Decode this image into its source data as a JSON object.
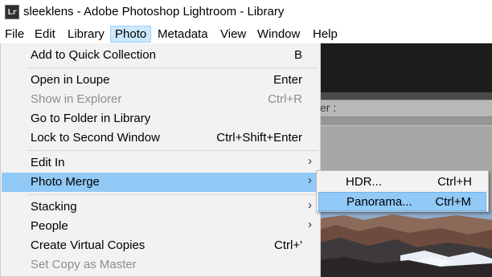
{
  "window": {
    "title": "sleeklens - Adobe Photoshop Lightroom - Library",
    "app_icon_text": "Lr"
  },
  "menubar": {
    "items": [
      "File",
      "Edit",
      "Library",
      "Photo",
      "Metadata",
      "View",
      "Window",
      "Help"
    ],
    "active": "Photo"
  },
  "background_app": {
    "filter_label": "er :"
  },
  "photo_menu": {
    "items": [
      {
        "label": "Add to Quick Collection",
        "shortcut": "B",
        "enabled": true
      },
      {
        "label": "Open in Loupe",
        "shortcut": "Enter",
        "enabled": true
      },
      {
        "label": "Show in Explorer",
        "shortcut": "Ctrl+R",
        "enabled": false
      },
      {
        "label": "Go to Folder in Library",
        "shortcut": "",
        "enabled": true
      },
      {
        "label": "Lock to Second Window",
        "shortcut": "Ctrl+Shift+Enter",
        "enabled": true
      },
      {
        "label": "Edit In",
        "submenu": true,
        "enabled": true
      },
      {
        "label": "Photo Merge",
        "submenu": true,
        "enabled": true,
        "highlighted": true
      },
      {
        "label": "Stacking",
        "submenu": true,
        "enabled": true
      },
      {
        "label": "People",
        "submenu": true,
        "enabled": true
      },
      {
        "label": "Create Virtual Copies",
        "shortcut": "Ctrl+'",
        "enabled": true
      },
      {
        "label": "Set Copy as Master",
        "shortcut": "",
        "enabled": false
      }
    ],
    "submenu_arrow": "›"
  },
  "photo_merge_submenu": {
    "items": [
      {
        "label": "HDR...",
        "shortcut": "Ctrl+H"
      },
      {
        "label": "Panorama...",
        "shortcut": "Ctrl+M",
        "highlighted": true
      }
    ]
  },
  "colors": {
    "menu_bg": "#f2f2f2",
    "highlight": "#91c9f7",
    "menubar_active": "#cce8ff",
    "disabled_text": "#8d8d8d",
    "app_dark": "#1c1c1c"
  }
}
